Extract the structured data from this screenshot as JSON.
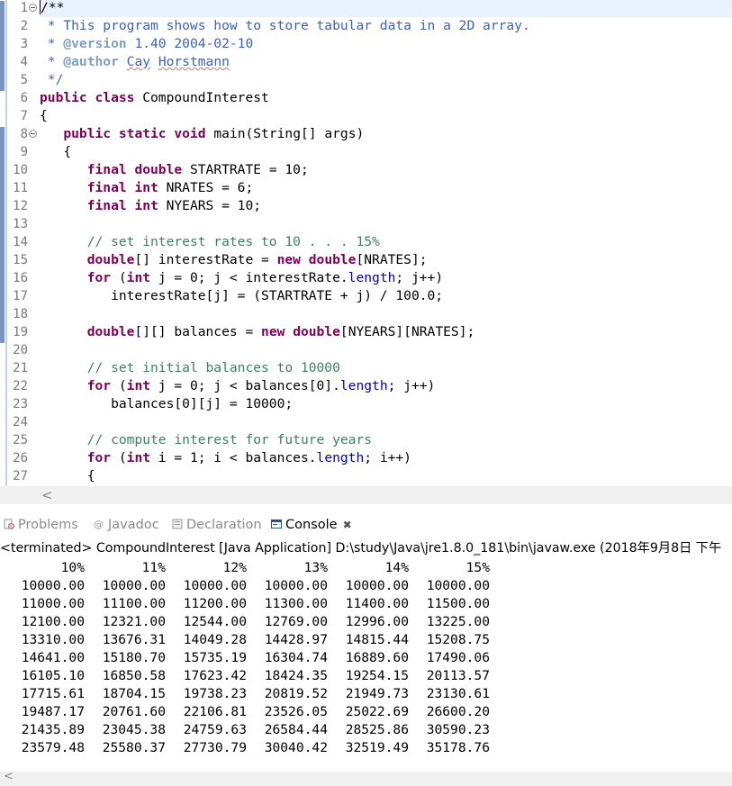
{
  "colors": {
    "keyword": "#7f0055",
    "comment": "#3f7f5f",
    "javadoc": "#3f5fbf",
    "javadoc_tag": "#7f9fbf",
    "field": "#0000c0",
    "current_line": "#e8f2fe",
    "line_number": "#787878"
  },
  "editor": {
    "lines": [
      [
        [
          "plain",
          "/**"
        ]
      ],
      [
        [
          "jd",
          " * This program shows how to store tabular data in a 2D array."
        ]
      ],
      [
        [
          "jd",
          " * "
        ],
        [
          "jdt",
          "@version"
        ],
        [
          "jd",
          " 1.40 2004-02-10"
        ]
      ],
      [
        [
          "jd",
          " * "
        ],
        [
          "jdt",
          "@author"
        ],
        [
          "jd",
          " "
        ],
        [
          "jdsq",
          "Cay"
        ],
        [
          "jd",
          " "
        ],
        [
          "jdsq",
          "Horstmann"
        ]
      ],
      [
        [
          "jd",
          " */"
        ]
      ],
      [
        [
          "kw",
          "public"
        ],
        [
          "plain",
          " "
        ],
        [
          "kw",
          "class"
        ],
        [
          "plain",
          " CompoundInterest"
        ]
      ],
      [
        [
          "plain",
          "{"
        ]
      ],
      [
        [
          "plain",
          "   "
        ],
        [
          "kw",
          "public"
        ],
        [
          "plain",
          " "
        ],
        [
          "kw",
          "static"
        ],
        [
          "plain",
          " "
        ],
        [
          "kw",
          "void"
        ],
        [
          "plain",
          " main(String[] args)"
        ]
      ],
      [
        [
          "plain",
          "   {"
        ]
      ],
      [
        [
          "plain",
          "      "
        ],
        [
          "kw",
          "final"
        ],
        [
          "plain",
          " "
        ],
        [
          "kw",
          "double"
        ],
        [
          "plain",
          " STARTRATE = 10;"
        ]
      ],
      [
        [
          "plain",
          "      "
        ],
        [
          "kw",
          "final"
        ],
        [
          "plain",
          " "
        ],
        [
          "kw",
          "int"
        ],
        [
          "plain",
          " NRATES = 6;"
        ]
      ],
      [
        [
          "plain",
          "      "
        ],
        [
          "kw",
          "final"
        ],
        [
          "plain",
          " "
        ],
        [
          "kw",
          "int"
        ],
        [
          "plain",
          " NYEARS = 10;"
        ]
      ],
      [
        [
          "plain",
          ""
        ]
      ],
      [
        [
          "plain",
          "      "
        ],
        [
          "cmt",
          "// set interest rates to 10 . . . 15%"
        ]
      ],
      [
        [
          "plain",
          "      "
        ],
        [
          "kw",
          "double"
        ],
        [
          "plain",
          "[] interestRate = "
        ],
        [
          "kw",
          "new"
        ],
        [
          "plain",
          " "
        ],
        [
          "kw",
          "double"
        ],
        [
          "plain",
          "[NRATES];"
        ]
      ],
      [
        [
          "plain",
          "      "
        ],
        [
          "kw",
          "for"
        ],
        [
          "plain",
          " ("
        ],
        [
          "kw",
          "int"
        ],
        [
          "plain",
          " j = 0; j < interestRate."
        ],
        [
          "fld",
          "length"
        ],
        [
          "plain",
          "; j++)"
        ]
      ],
      [
        [
          "plain",
          "         interestRate[j] = (STARTRATE + j) / 100.0;"
        ]
      ],
      [
        [
          "plain",
          ""
        ]
      ],
      [
        [
          "plain",
          "      "
        ],
        [
          "kw",
          "double"
        ],
        [
          "plain",
          "[][] balances = "
        ],
        [
          "kw",
          "new"
        ],
        [
          "plain",
          " "
        ],
        [
          "kw",
          "double"
        ],
        [
          "plain",
          "[NYEARS][NRATES];"
        ]
      ],
      [
        [
          "plain",
          ""
        ]
      ],
      [
        [
          "plain",
          "      "
        ],
        [
          "cmt",
          "// set initial balances to 10000"
        ]
      ],
      [
        [
          "plain",
          "      "
        ],
        [
          "kw",
          "for"
        ],
        [
          "plain",
          " ("
        ],
        [
          "kw",
          "int"
        ],
        [
          "plain",
          " j = 0; j < balances[0]."
        ],
        [
          "fld",
          "length"
        ],
        [
          "plain",
          "; j++)"
        ]
      ],
      [
        [
          "plain",
          "         balances[0][j] = 10000;"
        ]
      ],
      [
        [
          "plain",
          ""
        ]
      ],
      [
        [
          "plain",
          "      "
        ],
        [
          "cmt",
          "// compute interest for future years"
        ]
      ],
      [
        [
          "plain",
          "      "
        ],
        [
          "kw",
          "for"
        ],
        [
          "plain",
          " ("
        ],
        [
          "kw",
          "int"
        ],
        [
          "plain",
          " i = 1; i < balances."
        ],
        [
          "fld",
          "length"
        ],
        [
          "plain",
          "; i++)"
        ]
      ],
      [
        [
          "plain",
          "      {"
        ]
      ]
    ]
  },
  "tabs": [
    {
      "label": "Problems",
      "icon": "problems-icon",
      "active": false
    },
    {
      "label": "Javadoc",
      "icon": "at-icon",
      "active": false
    },
    {
      "label": "Declaration",
      "icon": "declaration-icon",
      "active": false
    },
    {
      "label": "Console",
      "icon": "console-icon",
      "active": true
    }
  ],
  "console": {
    "status": "<terminated> CompoundInterest [Java Application] D:\\study\\Java\\jre1.8.0_181\\bin\\javaw.exe (2018年9月8日 下午",
    "headers": [
      "10%",
      "11%",
      "12%",
      "13%",
      "14%",
      "15%"
    ],
    "rows": [
      [
        "10000.00",
        "10000.00",
        "10000.00",
        "10000.00",
        "10000.00",
        "10000.00"
      ],
      [
        "11000.00",
        "11100.00",
        "11200.00",
        "11300.00",
        "11400.00",
        "11500.00"
      ],
      [
        "12100.00",
        "12321.00",
        "12544.00",
        "12769.00",
        "12996.00",
        "13225.00"
      ],
      [
        "13310.00",
        "13676.31",
        "14049.28",
        "14428.97",
        "14815.44",
        "15208.75"
      ],
      [
        "14641.00",
        "15180.70",
        "15735.19",
        "16304.74",
        "16889.60",
        "17490.06"
      ],
      [
        "16105.10",
        "16850.58",
        "17623.42",
        "18424.35",
        "19254.15",
        "20113.57"
      ],
      [
        "17715.61",
        "18704.15",
        "19738.23",
        "20819.52",
        "21949.73",
        "23130.61"
      ],
      [
        "19487.17",
        "20761.60",
        "22106.81",
        "23526.05",
        "25022.69",
        "26600.20"
      ],
      [
        "21435.89",
        "23045.38",
        "24759.63",
        "26584.44",
        "28525.86",
        "30590.23"
      ],
      [
        "23579.48",
        "25580.37",
        "27730.79",
        "30040.42",
        "32519.49",
        "35178.76"
      ]
    ]
  }
}
